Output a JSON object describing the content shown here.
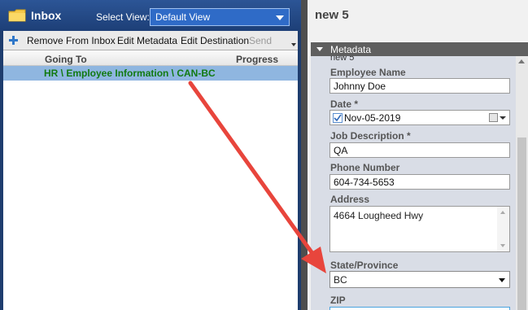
{
  "inbox": {
    "title": "Inbox",
    "select_view_label": "Select View:",
    "selected_view": "Default View",
    "icons": {
      "folder": "folder-icon",
      "view_caret": "chevron-down-icon"
    }
  },
  "toolbar": {
    "add_icon": "add-icon",
    "remove_label": "Remove From Inbox",
    "edit_metadata_label": "Edit Metadata",
    "edit_destination_label": "Edit Destination",
    "send_label": "Send"
  },
  "list": {
    "columns": [
      "Going To",
      "Progress"
    ],
    "rows": [
      {
        "going_to": "HR \\ Employee Information \\ CAN-BC",
        "progress": ""
      }
    ]
  },
  "document": {
    "title": "new 5",
    "metadata_section": "Metadata",
    "cutoff_text": "new 5",
    "fields": {
      "employee_name": {
        "label": "Employee Name",
        "value": "Johnny Doe"
      },
      "date": {
        "label": "Date *",
        "value": "Nov-05-2019",
        "checked": true
      },
      "job_description": {
        "label": "Job Description *",
        "value": "QA"
      },
      "phone_number": {
        "label": "Phone Number",
        "value": "604-734-5653"
      },
      "address": {
        "label": "Address",
        "value": "4664 Lougheed Hwy"
      },
      "state_province": {
        "label": "State/Province",
        "value": "BC"
      },
      "zip": {
        "label": "ZIP",
        "value": ""
      }
    }
  },
  "colors": {
    "inbox_header": "#1d3f77",
    "selected_row": "#8fb6e0",
    "destination_text": "#127a12",
    "annotation_arrow": "#e8453c"
  }
}
